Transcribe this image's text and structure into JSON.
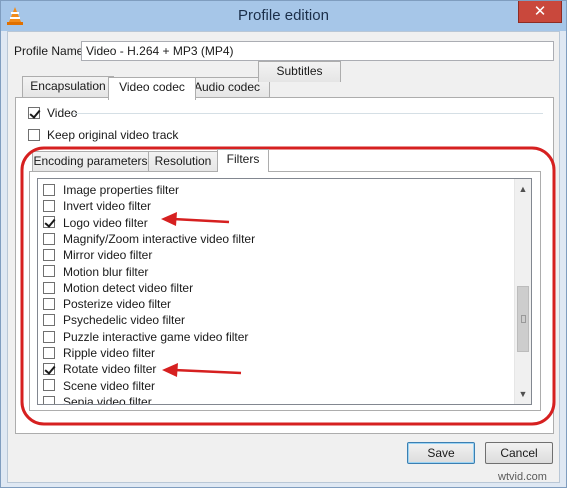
{
  "window": {
    "title": "Profile edition",
    "close_glyph": "✕",
    "app_icon": "vlc-cone-icon",
    "titlebar_color": "#a6c6e8",
    "close_color": "#c9483c"
  },
  "profile": {
    "name_label": "Profile Name",
    "name_value": "Video - H.264 + MP3 (MP4)"
  },
  "tabs": [
    {
      "label": "Encapsulation",
      "active": false
    },
    {
      "label": "Video codec",
      "active": true
    },
    {
      "label": "Audio codec",
      "active": false
    },
    {
      "label": "Subtitles",
      "active": false
    }
  ],
  "video": {
    "video_label": "Video",
    "video_checked": true,
    "keep_original_label": "Keep original video track",
    "keep_original_checked": false
  },
  "subtabs": [
    {
      "label": "Encoding parameters",
      "active": false
    },
    {
      "label": "Resolution",
      "active": false
    },
    {
      "label": "Filters",
      "active": true
    }
  ],
  "filters": [
    {
      "label": "Image properties filter",
      "checked": false
    },
    {
      "label": "Invert video filter",
      "checked": false
    },
    {
      "label": "Logo video filter",
      "checked": true
    },
    {
      "label": "Magnify/Zoom interactive video filter",
      "checked": false
    },
    {
      "label": "Mirror video filter",
      "checked": false
    },
    {
      "label": "Motion blur filter",
      "checked": false
    },
    {
      "label": "Motion detect video filter",
      "checked": false
    },
    {
      "label": "Posterize video filter",
      "checked": false
    },
    {
      "label": "Psychedelic video filter",
      "checked": false
    },
    {
      "label": "Puzzle interactive game video filter",
      "checked": false
    },
    {
      "label": "Ripple video filter",
      "checked": false
    },
    {
      "label": "Rotate video filter",
      "checked": true
    },
    {
      "label": "Scene video filter",
      "checked": false
    },
    {
      "label": "Sepia video filter",
      "checked": false
    }
  ],
  "buttons": {
    "save": "Save",
    "cancel": "Cancel"
  },
  "annotation": {
    "color": "#d62020"
  },
  "watermark": "wtvid.com"
}
